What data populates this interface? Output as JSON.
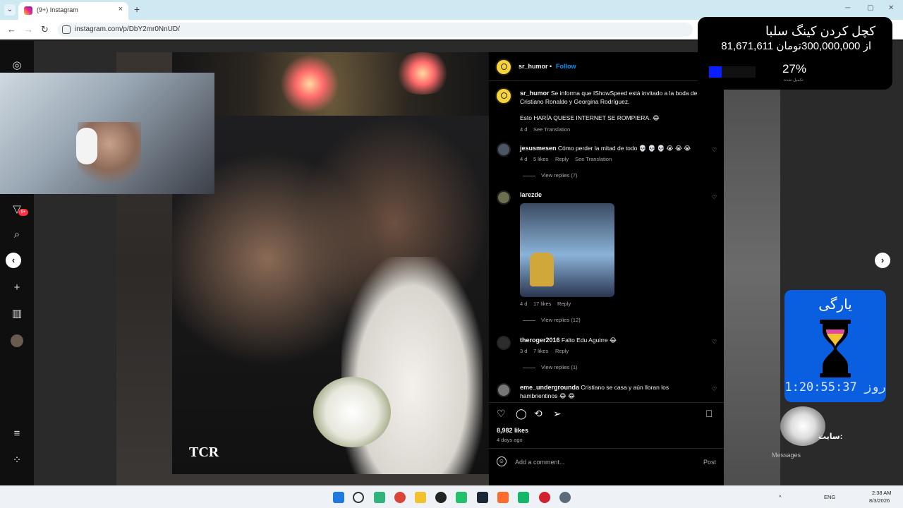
{
  "browser": {
    "tab_title": "(9+) Instagram",
    "tab_close": "×",
    "new_tab": "+",
    "url": "instagram.com/p/DbY2mr0NnUD/",
    "back": "←",
    "forward": "→",
    "reload": "↻",
    "minimize": "─",
    "maximize": "▢",
    "close": "✕"
  },
  "post": {
    "author": "sr_humor",
    "follow_label": "Follow",
    "separator": "•",
    "caption_line1": "Se informa que IShowSpeed está invitado a la boda de",
    "caption_line2": "Cristiano Ronaldo y Georgina Rodríguez.",
    "caption_line3": "Esto HARÍA QUESE INTERNET SE ROMPIERA. 😂",
    "caption_time": "4 d",
    "see_translation": "See Translation",
    "image_watermark": "TCR",
    "likes": "8,982 likes",
    "posted_ago": "4 days ago",
    "add_comment_placeholder": "Add a comment...",
    "post_label": "Post"
  },
  "comments": [
    {
      "user": "jesusmesen",
      "text": "Cómo perder la mitad de todo 💀 💀 💀 😭 😭 😭",
      "time": "4 d",
      "likes": "5 likes",
      "reply": "Reply",
      "translate": "See Translation",
      "replies": "View replies (7)"
    },
    {
      "user": "larezde",
      "text": "",
      "time": "4 d",
      "likes": "17 likes",
      "reply": "Reply",
      "replies": "View replies (12)"
    },
    {
      "user": "theroger2016",
      "text": "Falto Edu Aguirre 😂",
      "time": "3 d",
      "likes": "7 likes",
      "reply": "Reply",
      "replies": "View replies (1)"
    },
    {
      "user": "eme_undergrounda",
      "text_line1": "Cristiano se casa y aún lloran los",
      "text_line2": "hambrientinos 😂 😂"
    }
  ],
  "overlays": {
    "donate_title": "کچل کردن کینگ سلبا",
    "donate_amount": "81,671,611 از 300,000,000تومان",
    "donate_percent": "27%",
    "donate_progress": 0.27,
    "donate_sub": "تکمیل شده",
    "timer_title": "یارگی",
    "timer_count": "1:20:55:37 روز",
    "seal_text": "سایت:",
    "messages_label": "Messages"
  },
  "taskbar": {
    "lang": "ENG",
    "time": "2:38 AM",
    "date": "8/3/2026",
    "up_arrow": "^"
  },
  "colors": {
    "instagram_blue": "#0095f6",
    "donate_bar": "#0a1fff",
    "timer_bg": "#0a5fe0",
    "notification_red": "#ff3040"
  }
}
